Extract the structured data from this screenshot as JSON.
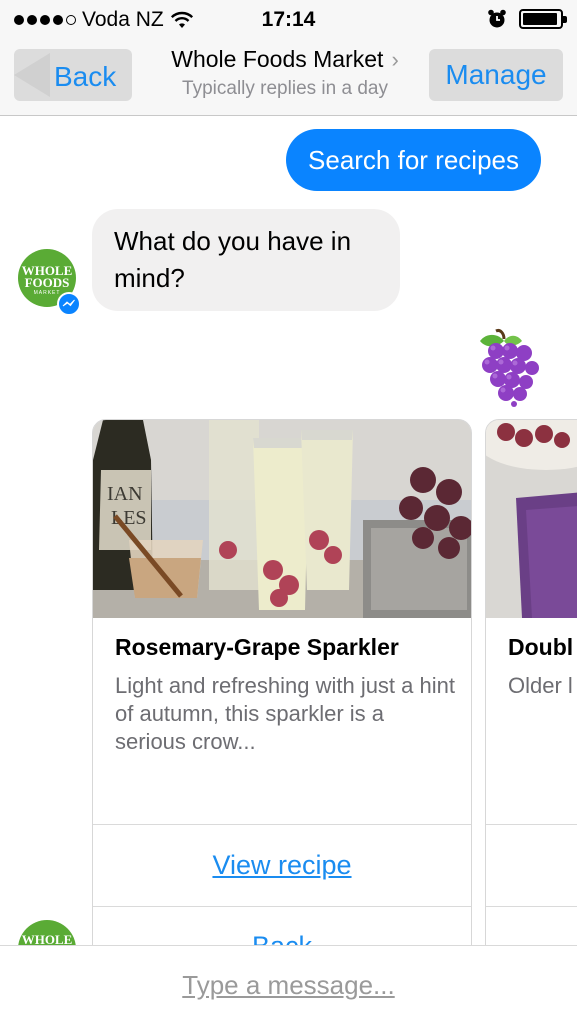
{
  "status_bar": {
    "carrier": "Voda NZ",
    "time": "17:14",
    "signal_bars_filled": 4,
    "battery_level": 0.95
  },
  "nav": {
    "back_label": "Back",
    "title": "Whole Foods Market",
    "subtitle": "Typically replies in a day",
    "manage_label": "Manage"
  },
  "messages": {
    "outgoing_text": "Search for recipes",
    "incoming_text": "What do you have in mind?",
    "emoji_icon": "grapes-emoji"
  },
  "avatar": {
    "logo_line1": "WHOLE",
    "logo_line2": "FOODS",
    "logo_line3": "MARKET"
  },
  "cards": [
    {
      "title": "Rosemary-Grape Sparkler",
      "description": "Light and refreshing with just a hint of autumn, this sparkler is a serious crow...",
      "primary_button": "View recipe",
      "secondary_button": "Back"
    },
    {
      "title": "Doubl",
      "description": "Older l these t younge helper."
    }
  ],
  "composer": {
    "placeholder": "Type a message..."
  },
  "colors": {
    "accent": "#1a8cf0",
    "bubble_out": "#0a84ff",
    "bubble_in": "#f1f0f0",
    "brand_green": "#5aab35"
  }
}
